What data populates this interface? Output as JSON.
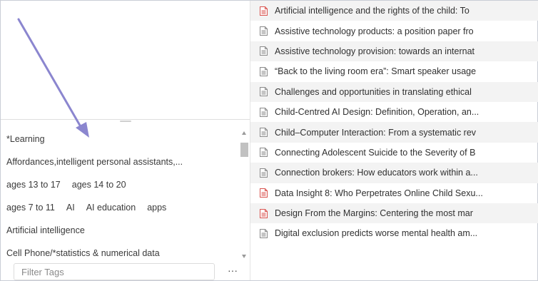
{
  "tag_selector": {
    "rows": [
      [
        "*Learning"
      ],
      [
        "Affordances,intelligent personal assistants,..."
      ],
      [
        "ages 13 to 17",
        "ages 14 to 20"
      ],
      [
        "ages 7 to 11",
        "AI",
        "AI education",
        "apps"
      ],
      [
        "Artificial intelligence"
      ],
      [
        "Cell Phone/*statistics & numerical data"
      ]
    ],
    "filter_placeholder": "Filter Tags",
    "more_label": "···"
  },
  "items": [
    {
      "type": "pdf",
      "title": "Artificial intelligence and the rights of the child: To"
    },
    {
      "type": "doc",
      "title": "Assistive technology products: a position paper fro"
    },
    {
      "type": "doc",
      "title": "Assistive technology provision: towards an internat"
    },
    {
      "type": "doc",
      "title": "“Back to the living room era”: Smart speaker usage"
    },
    {
      "type": "doc",
      "title": "Challenges and opportunities in translating ethical"
    },
    {
      "type": "doc",
      "title": "Child-Centred AI Design: Definition, Operation, an..."
    },
    {
      "type": "doc",
      "title": "Child–Computer Interaction: From a systematic rev"
    },
    {
      "type": "doc",
      "title": "Connecting Adolescent Suicide to the Severity of B"
    },
    {
      "type": "doc",
      "title": "Connection brokers: How educators work within a..."
    },
    {
      "type": "pdf",
      "title": "Data Insight 8: Who Perpetrates Online Child Sexu..."
    },
    {
      "type": "pdf",
      "title": "Design From the Margins: Centering the most mar"
    },
    {
      "type": "doc",
      "title": "Digital exclusion predicts worse mental health am..."
    }
  ],
  "colors": {
    "arrow": "#8b86cf",
    "pdf_icon": "#d9534f",
    "doc_icon": "#8a8a8a",
    "row_alt": "#f3f3f3"
  }
}
